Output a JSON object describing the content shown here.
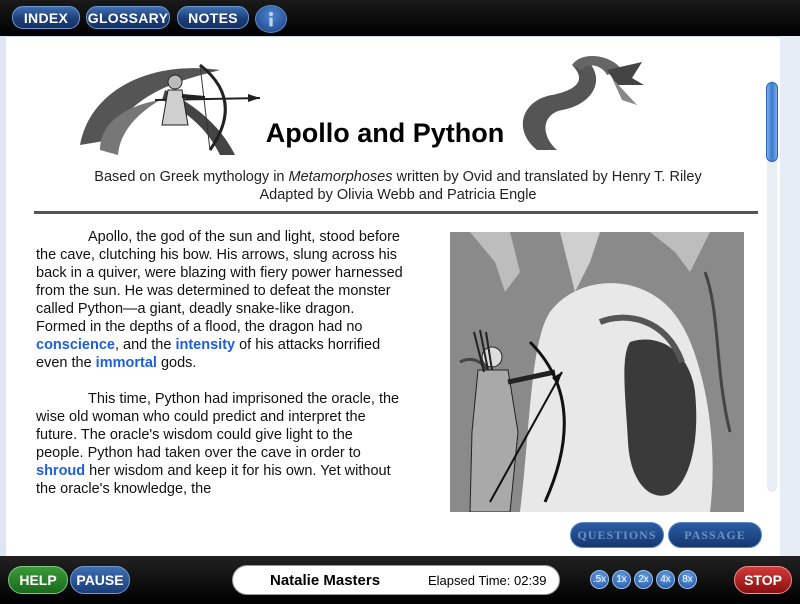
{
  "toolbar": {
    "index_label": "INDEX",
    "glossary_label": "GLOSSARY",
    "notes_label": "NOTES",
    "info_icon": "info-icon"
  },
  "passage": {
    "title": "Apollo and Python",
    "credit_prefix": "Based on Greek mythology in ",
    "credit_work": "Metamorphoses",
    "credit_suffix": " written by Ovid and translated by Henry T. Riley",
    "credit_line2": "Adapted by Olivia Webb and Patricia Engle",
    "p1_a": "Apollo, the god of the sun and light, stood before the cave, clutching his bow. His arrows, slung across his back in a quiver, were blazing with fiery power harnessed from the sun. He was determined to defeat the monster called Python—a giant, deadly snake-like dragon. Formed in the depths of a flood, the dragon had no ",
    "p1_w1": "conscience",
    "p1_b": ", and the ",
    "p1_w2": "intensity",
    "p1_c": " of his attacks horrified even the ",
    "p1_w3": "immortal",
    "p1_d": " gods.",
    "p2_a": "This time, Python had imprisoned the oracle, the wise old woman who could predict and interpret the future. The oracle's wisdom could give light to the people. Python had taken over the cave in order to ",
    "p2_w1": "shroud",
    "p2_b": " her wisdom and keep it for his own. Yet without the oracle's knowledge, the"
  },
  "nav": {
    "questions_label": "QUESTIONS",
    "passage_label": "PASSAGE"
  },
  "footer": {
    "help_label": "HELP",
    "pause_label": "PAUSE",
    "student_name": "Natalie Masters",
    "elapsed": "Elapsed Time: 02:39",
    "speeds": [
      ".5x",
      "1x",
      "2x",
      "4x",
      "8x"
    ],
    "stop_label": "STOP"
  }
}
